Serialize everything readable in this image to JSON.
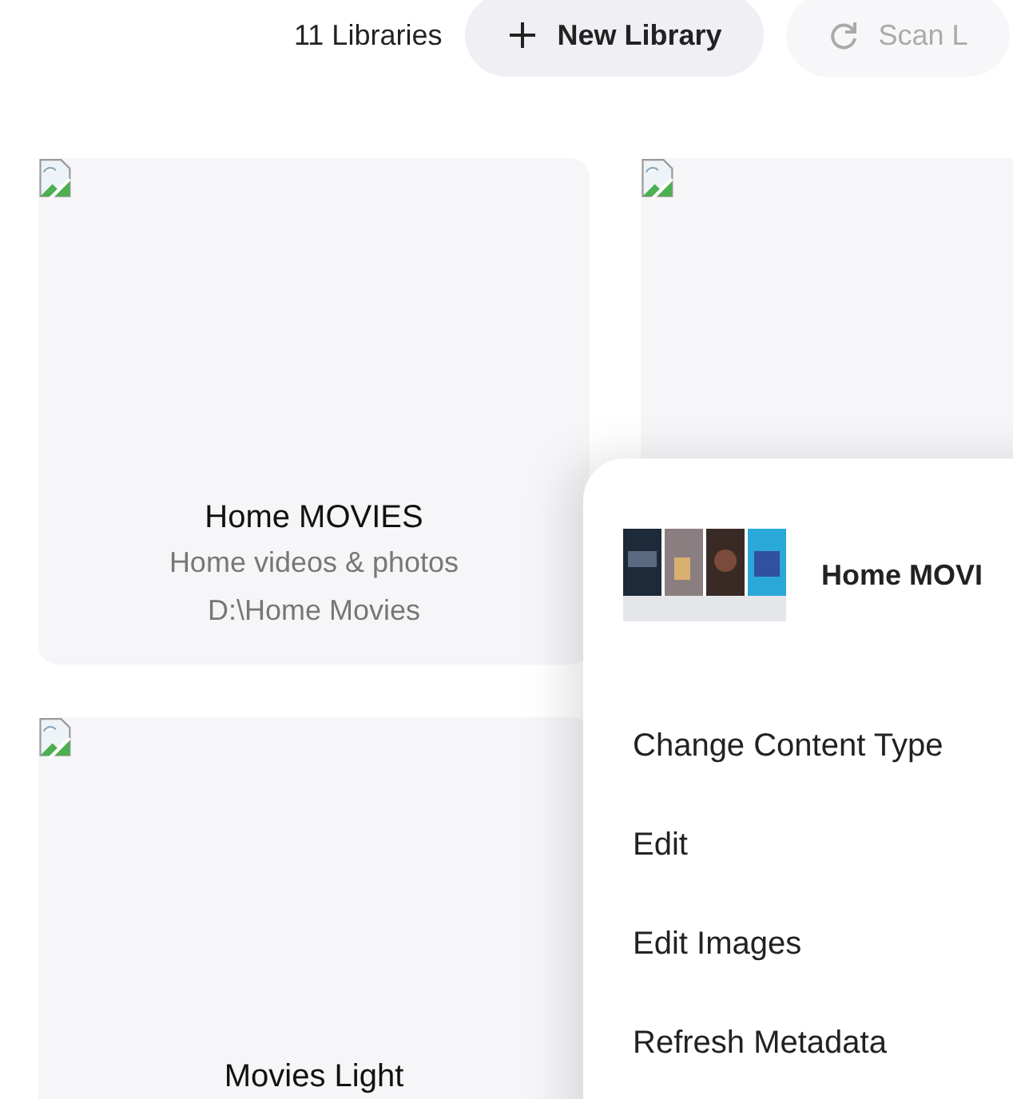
{
  "toolbar": {
    "count": "11 Libraries",
    "buttons": [
      {
        "label": "New Library",
        "disabled": false
      },
      {
        "label": "Scan L",
        "disabled": true
      }
    ]
  },
  "libraries": [
    {
      "kind": "library",
      "title": "Home MOVIES",
      "description": "Home videos & photos",
      "path": "D:\\Home Movies"
    },
    {
      "kind": "library"
    },
    {
      "kind": "library",
      "title": "Movies Light"
    }
  ],
  "context_menu": {
    "title": "Home MOVI",
    "items": [
      "Change Content Type",
      "Edit",
      "Edit Images",
      "Refresh Metadata"
    ]
  }
}
